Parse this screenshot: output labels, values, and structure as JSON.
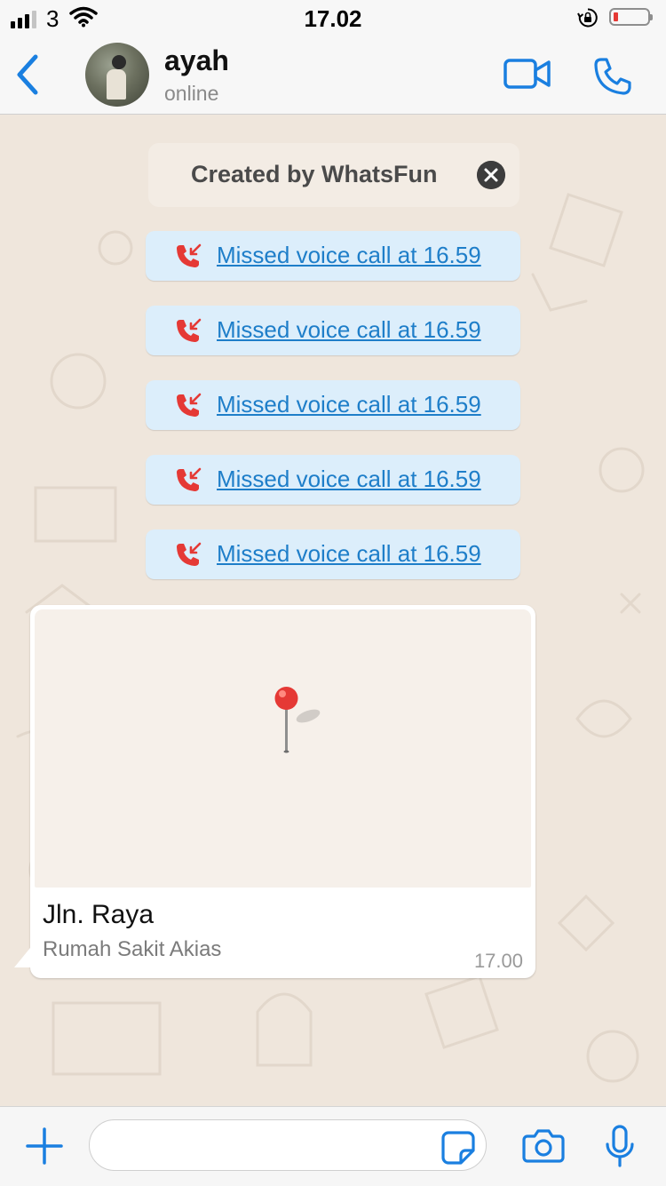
{
  "status_bar": {
    "carrier": "3",
    "time": "17.02",
    "signal_bars": 3,
    "battery_level": 0.1,
    "icons": [
      "signal-icon",
      "wifi-icon",
      "orientation-lock-icon",
      "battery-icon"
    ]
  },
  "header": {
    "contact_name": "ayah",
    "presence": "online",
    "accent_color": "#1a7fe0",
    "icons": [
      "back-chevron-icon",
      "video-call-icon",
      "phone-icon"
    ]
  },
  "banner": {
    "text": "Created by WhatsFun",
    "close_icon": "close-icon"
  },
  "missed_calls": [
    {
      "label": "Missed voice call at 16.59"
    },
    {
      "label": "Missed voice call at 16.59"
    },
    {
      "label": "Missed voice call at 16.59"
    },
    {
      "label": "Missed voice call at 16.59"
    },
    {
      "label": "Missed voice call at 16.59"
    }
  ],
  "location_message": {
    "place_name": "Jln. Raya",
    "address": "Rumah Sakit Akias",
    "time": "17.00",
    "pin_color": "#e53935"
  },
  "composer": {
    "placeholder": "",
    "icons": [
      "plus-icon",
      "sticker-icon",
      "camera-icon",
      "microphone-icon"
    ]
  },
  "colors": {
    "chat_background": "#efe6dc",
    "missed_call_bubble": "#dceefb",
    "missed_call_text": "#1e7ec9",
    "missed_call_icon": "#e53935"
  }
}
